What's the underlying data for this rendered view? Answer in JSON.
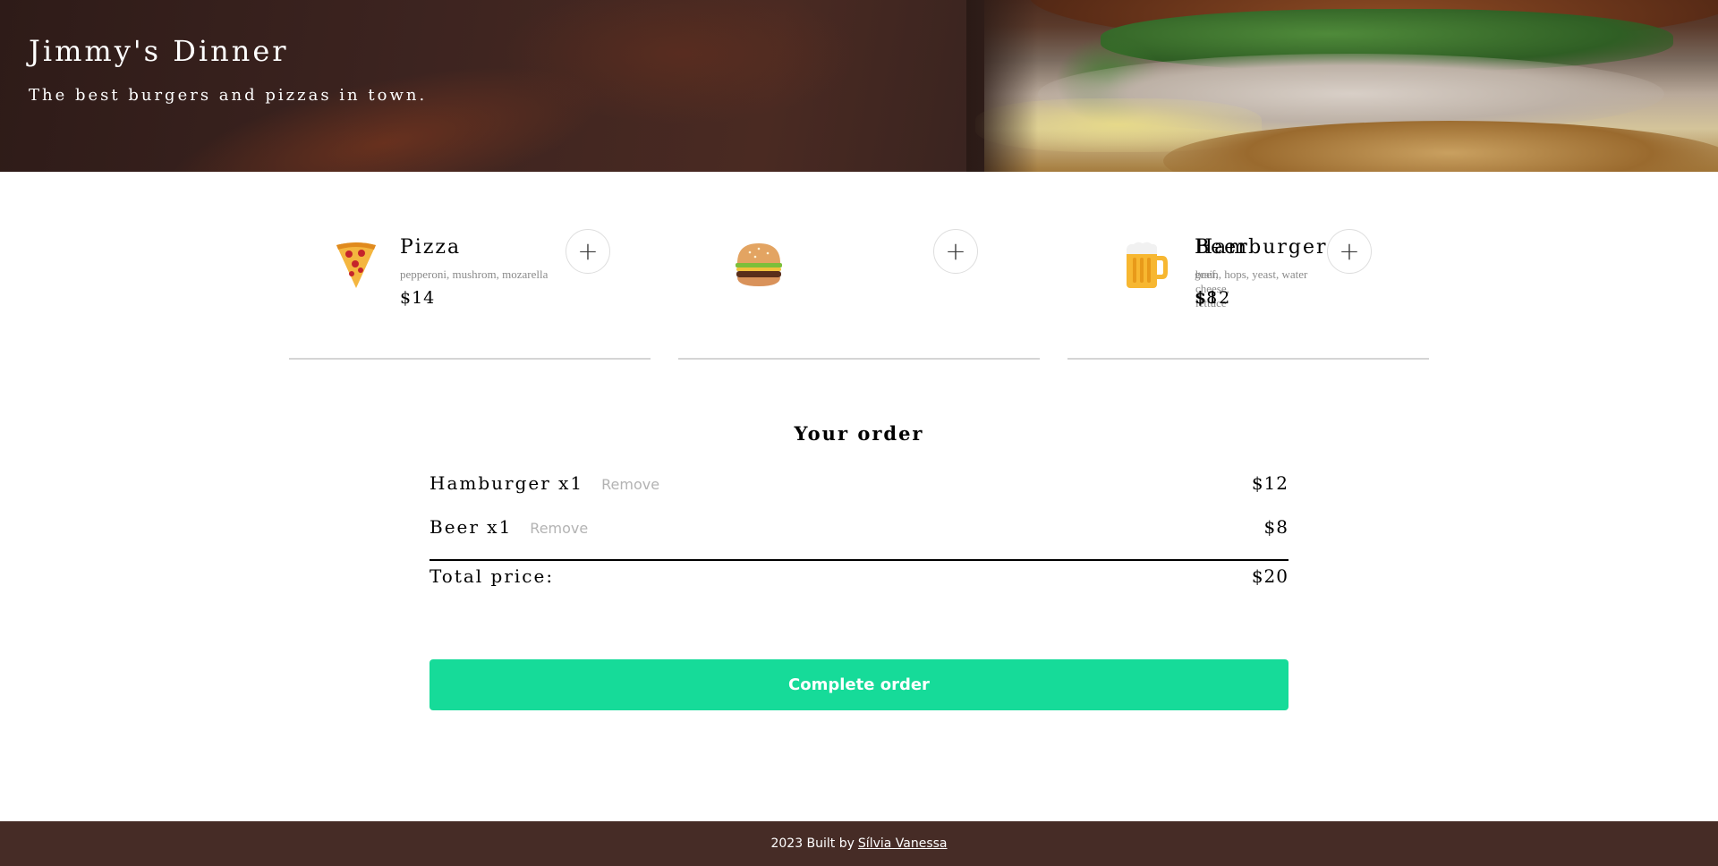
{
  "header": {
    "title": "Jimmy's Dinner",
    "subtitle": "The best burgers and pizzas in town."
  },
  "menu": {
    "items": [
      {
        "icon": "pizza-icon",
        "name": "Pizza",
        "ingredients": "pepperoni, mushrom, mozarella",
        "price": "$14",
        "add_label": "+"
      },
      {
        "icon": "hamburger-icon",
        "name": "Hamburger",
        "ingredients": "beef, cheese, lettuce",
        "price": "$12",
        "add_label": "+"
      },
      {
        "icon": "beer-icon",
        "name": "Beer",
        "ingredients": "grain, hops, yeast, water",
        "price": "$8",
        "add_label": "+"
      }
    ]
  },
  "order": {
    "title": "Your order",
    "items": [
      {
        "name": "Hamburger x1",
        "remove_label": "Remove",
        "price": "$12"
      },
      {
        "name": "Beer x1",
        "remove_label": "Remove",
        "price": "$8"
      }
    ],
    "total_label": "Total price:",
    "total_value": "$20",
    "complete_label": "Complete order"
  },
  "footer": {
    "text": "2023 Built by",
    "author_link": "Sílvia Vanessa"
  },
  "colors": {
    "accent": "#16db99",
    "footer_bg": "#462c26"
  }
}
